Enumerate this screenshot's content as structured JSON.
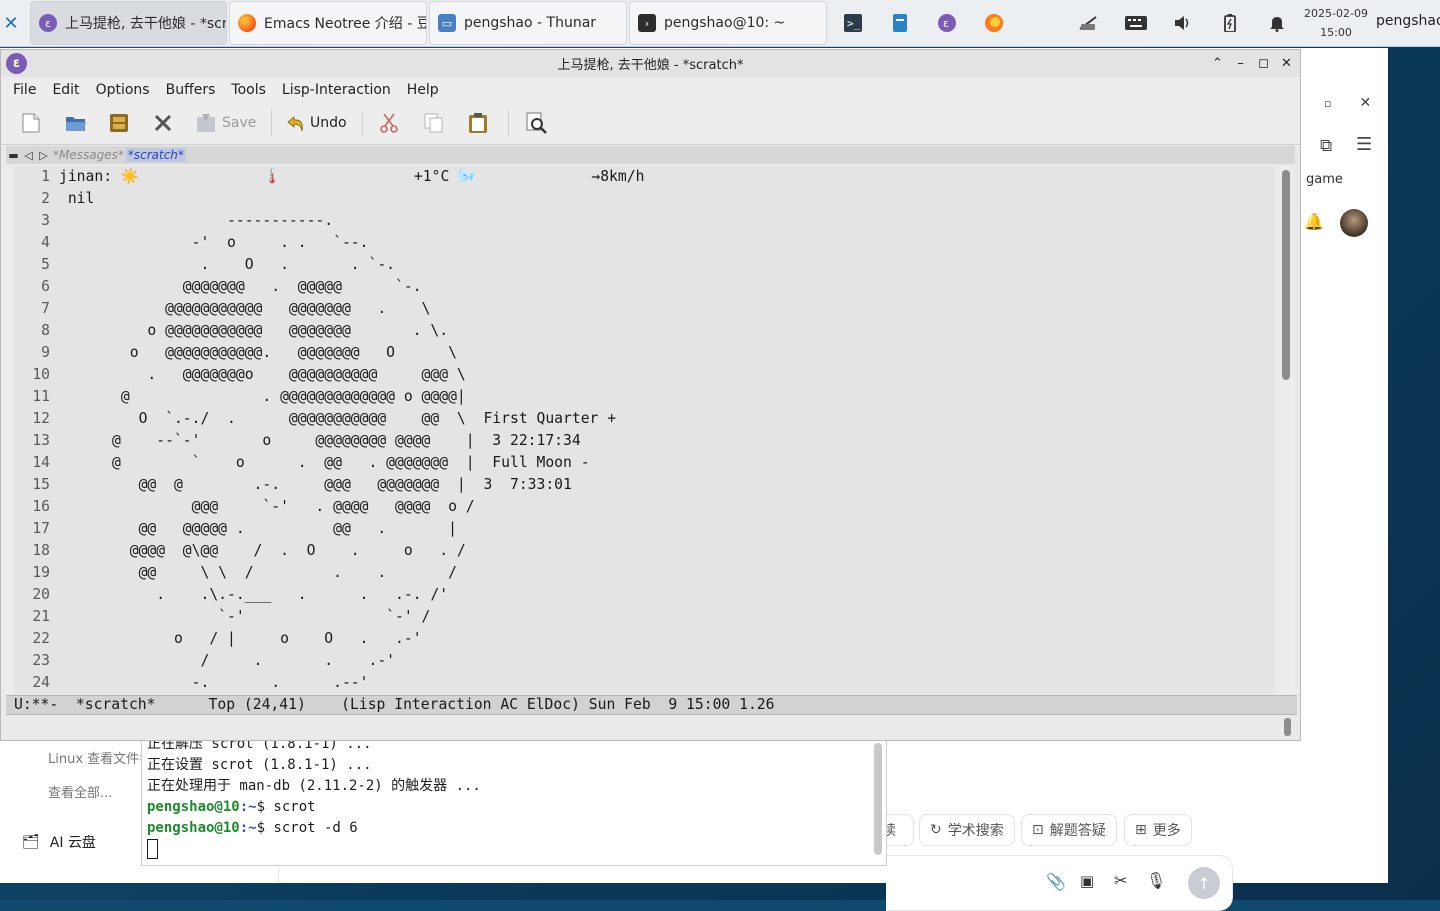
{
  "colors": {
    "accent": "#7a5bb5",
    "prompt": "#1d8a2e",
    "path": "#2a4fcf",
    "highlight": "#e2871f"
  },
  "panel": {
    "tasks": [
      {
        "icon": "emacs-icon",
        "label": "上马提枪, 去干他娘 - *scr…"
      },
      {
        "icon": "firefox-icon",
        "label": "Emacs Neotree 介绍 - 豆..."
      },
      {
        "icon": "folder-icon",
        "label": "pengshao - Thunar"
      },
      {
        "icon": "terminal-icon",
        "label": "pengshao@10: ~"
      }
    ],
    "date": "2025-02-09",
    "time": "15:00",
    "user": "pengshao"
  },
  "browser": {
    "side_links": [
      "Linux 查看文件名",
      "查看全部..."
    ],
    "ai_cloud": "AI 云盘",
    "partial_label": "game",
    "chips": [
      "读",
      "学术搜索",
      "解题答疑",
      "更多"
    ]
  },
  "terminal": {
    "lines": [
      "正在解压 scrot (1.8.1-1) ...",
      "正在设置 scrot (1.8.1-1) ...",
      "正在处理用于 man-db (2.11.2-2) 的触发器 ..."
    ],
    "prompt_user": "pengshao@10",
    "prompt_path": ":~",
    "cmd1": "$ scrot",
    "cmd2": "$ scrot -d 6"
  },
  "emacs": {
    "title": "上马提枪, 去干他娘 - *scratch*",
    "menus": [
      "File",
      "Edit",
      "Options",
      "Buffers",
      "Tools",
      "Lisp-Interaction",
      "Help"
    ],
    "toolbar": {
      "save": "Save",
      "undo": "Undo"
    },
    "tabs": {
      "inactive": "*Messages*",
      "active": "*scratch*"
    },
    "lines": [
      "jinan: ☀️              🌡️               +1°C 🌬️             →8km/h",
      " nil",
      "                   -----------.",
      "               -'  o     . .   `--.",
      "                .    O   .       . `-.",
      "              @@@@@@@   .  @@@@@      `-.",
      "            @@@@@@@@@@@   @@@@@@@   .    \\",
      "          o @@@@@@@@@@@   @@@@@@@       . \\.",
      "        o   @@@@@@@@@@@.   @@@@@@@   O      \\",
      "          .   @@@@@@@o    @@@@@@@@@@     @@@ \\",
      "       @               . @@@@@@@@@@@@@ o @@@@|",
      "         O  `.-./  .      @@@@@@@@@@@    @@  \\  First Quarter +",
      "      @    --`-'       o     @@@@@@@@ @@@@    |  3 22:17:34",
      "      @        `    o      .  @@   . @@@@@@@  |  Full Moon -",
      "         @@  @        .-.     @@@   @@@@@@@  |  3  7:33:01",
      "               @@@     `-'   . @@@@   @@@@  o /",
      "         @@   @@@@@ .          @@   .       |",
      "        @@@@  @\\@@    /  .  O    .     o   . /",
      "         @@     \\ \\  /         .    .       /",
      "           .    .\\.-.___   .      .   .-. /'",
      "                  `-'                `-' /",
      "             o   / |     o    O   .   .-'",
      "                /     .       .    .-'",
      "               -.       .      .--'"
    ],
    "modeline": "U:**-  *scratch*      Top (24,41)    (Lisp Interaction AC ElDoc) Sun Feb  9 15:00 1.26"
  }
}
